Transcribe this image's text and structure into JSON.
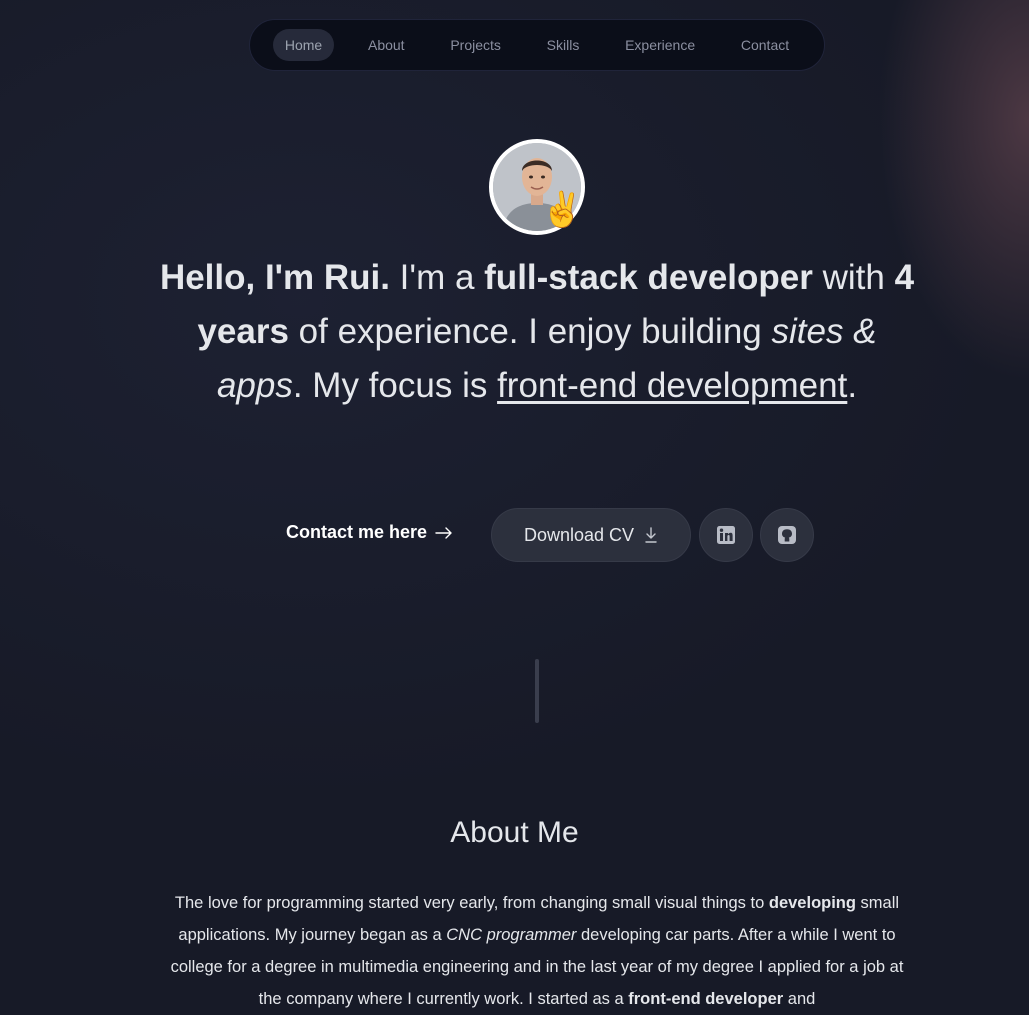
{
  "nav": {
    "items": [
      {
        "label": "Home"
      },
      {
        "label": "About"
      },
      {
        "label": "Projects"
      },
      {
        "label": "Skills"
      },
      {
        "label": "Experience"
      },
      {
        "label": "Contact"
      }
    ],
    "active": "Home"
  },
  "hero": {
    "avatar_icon": "profile-photo",
    "emoji": "✌️",
    "parts": {
      "greeting": "Hello, I'm Rui.",
      "t1": " I'm a ",
      "role": "full-stack developer",
      "t2": " with ",
      "years": "4 years",
      "t3": " of experience. I enjoy building ",
      "sites": "sites & apps",
      "t4": ". My focus is ",
      "focus": "front-end development",
      "t5": "."
    }
  },
  "actions": {
    "contact_label": "Contact me here",
    "contact_icon": "arrow-right-icon",
    "cv_label": "Download CV",
    "cv_icon": "download-icon",
    "linkedin_icon": "linkedin-icon",
    "github_icon": "github-icon"
  },
  "about": {
    "title": "About Me",
    "parts": {
      "a1": "The love for programming started very early, from changing small visual things to ",
      "a2": "developing",
      "a3": " small applications. My journey began as a ",
      "a4": "CNC programmer",
      "a5": " developing car parts. After a while I went to college for a degree in multimedia engineering and in the last year of my degree I applied for a job at the company where I currently work. I started as a ",
      "a6": "front-end developer",
      "a7": " and"
    }
  },
  "colors": {
    "background": "#171a27",
    "nav_bg": "#0b0e19",
    "button_bg": "#2c303d",
    "text": "#e5e7eb"
  }
}
